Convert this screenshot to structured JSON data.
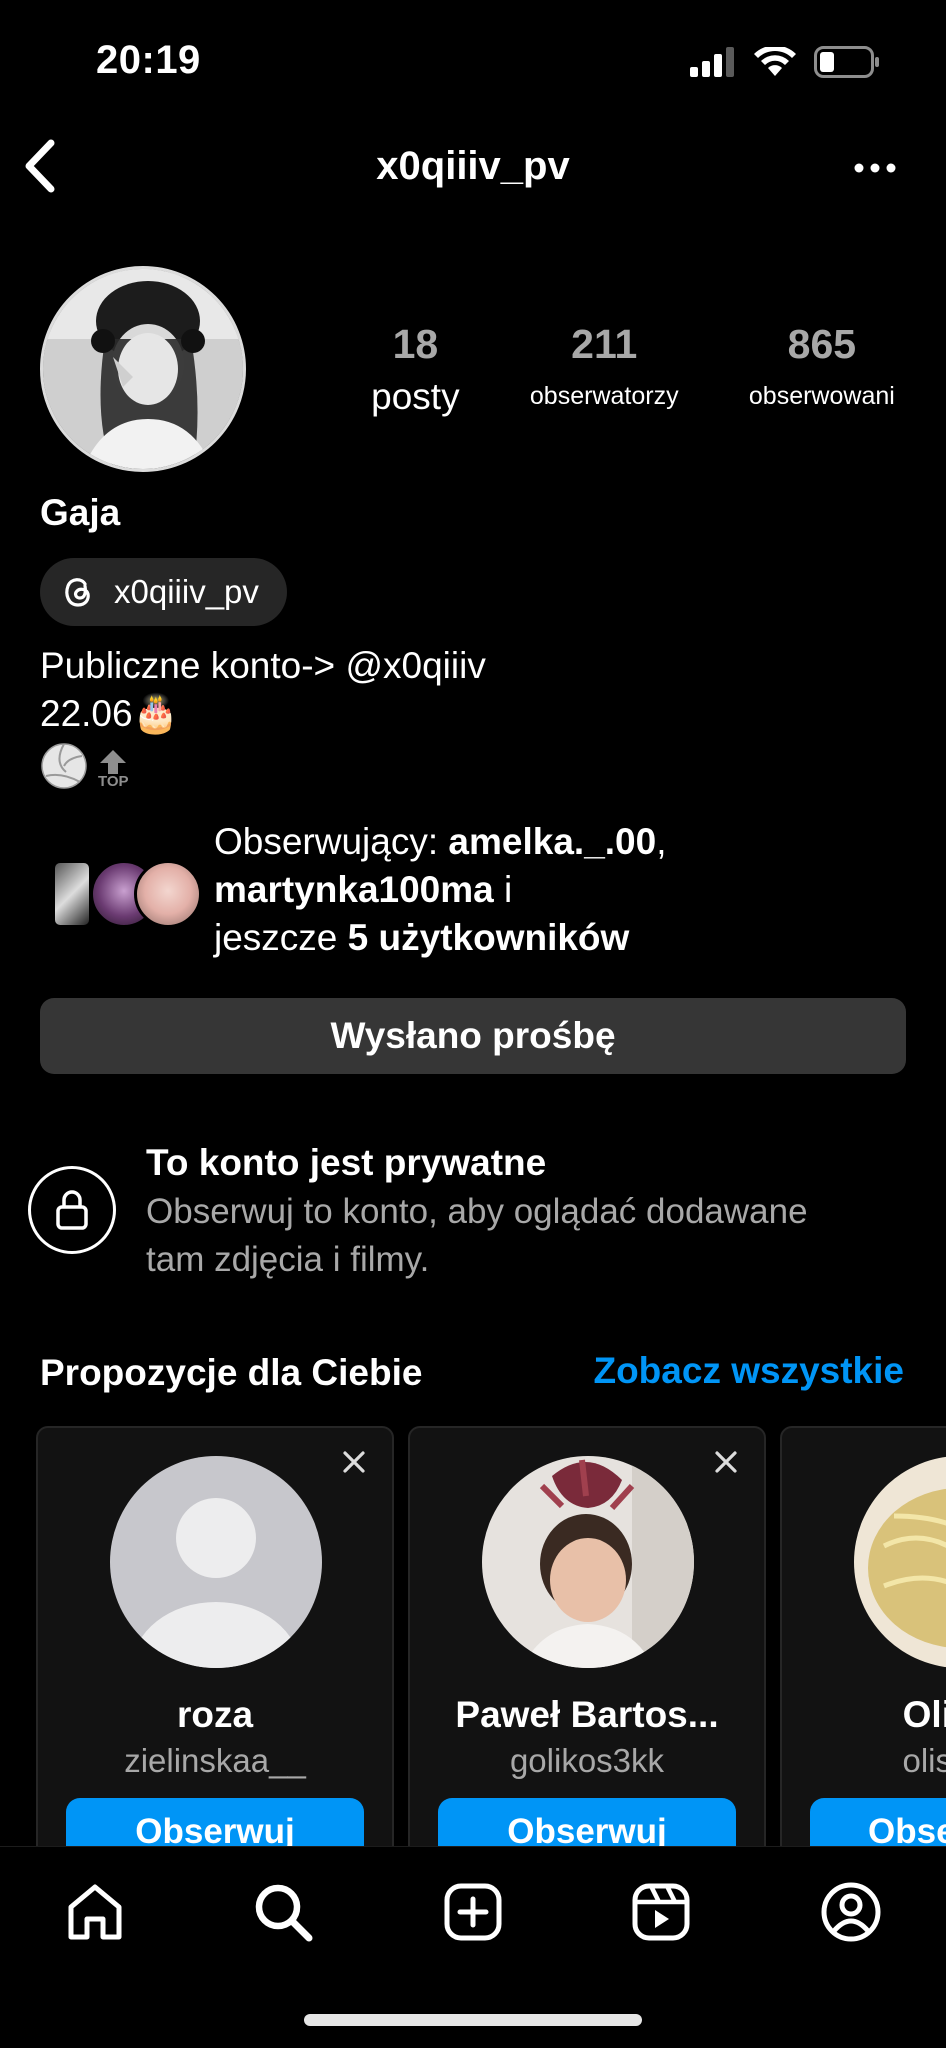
{
  "status_bar": {
    "time": "20:19"
  },
  "header": {
    "username": "x0qiiiv_pv"
  },
  "profile": {
    "display_name": "Gaja",
    "threads_handle": "x0qiiiv_pv",
    "stats": {
      "posts": {
        "value": "18",
        "label": "posty"
      },
      "followers": {
        "value": "211",
        "label": "obserwatorzy"
      },
      "following": {
        "value": "865",
        "label": "obserwowani"
      }
    },
    "bio": {
      "line1_prefix": "Publiczne konto-> ",
      "line1_mention": "@x0qiiiv",
      "line2": "22.06🎂",
      "line3_emoji": "🏐",
      "top_badge": "TOP"
    }
  },
  "mutuals": {
    "prefix": "Obserwujący: ",
    "user1": "amelka._.00",
    "sep1": ",",
    "user2": "martynka100ma",
    "and": " i",
    "more_prefix": "jeszcze ",
    "more_count": "5 użytkowników"
  },
  "request_button": {
    "label": "Wysłano prośbę"
  },
  "private_notice": {
    "title": "To konto jest prywatne",
    "description": "Obserwuj to konto, aby oglądać dodawane tam zdjęcia i filmy."
  },
  "suggestions": {
    "title": "Propozycje dla Ciebie",
    "see_all": "Zobacz wszystkie",
    "cards": [
      {
        "name": "roza",
        "username": "zielinskaa__",
        "follow_label": "Obserwuj"
      },
      {
        "name": "Paweł Bartos...",
        "username": "golikos3kk",
        "follow_label": "Obserwuj"
      },
      {
        "name": "Oli",
        "username": "olis",
        "follow_label": "Obse"
      }
    ]
  },
  "tabbar": {
    "icons": [
      "home-icon",
      "search-icon",
      "create-icon",
      "reels-icon",
      "profile-icon"
    ]
  },
  "colors": {
    "accent": "#0095f6",
    "secondary_text": "#a8a8a8",
    "button_bg": "#363636"
  }
}
